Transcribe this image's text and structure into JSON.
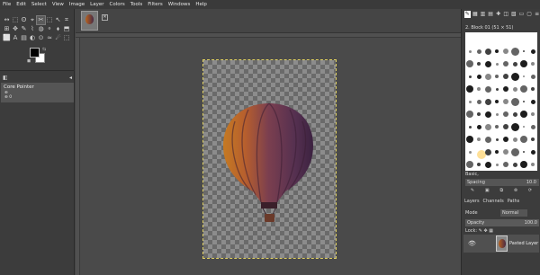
{
  "menu": [
    "File",
    "Edit",
    "Select",
    "View",
    "Image",
    "Layer",
    "Colors",
    "Tools",
    "Filters",
    "Windows",
    "Help"
  ],
  "toolbox": {
    "tools": [
      "↔",
      "⬚",
      "ʘ",
      "⌖",
      "✂",
      "⬚",
      "↖",
      "⌗",
      "⊞",
      "✥",
      "✎",
      "⌇",
      "◍",
      "⚬",
      "⬧",
      "⬒",
      "⬜",
      "A",
      "▤",
      "◐",
      "⊙",
      "≈",
      "☄",
      "⬚"
    ],
    "panel_tab": "◧",
    "panel_title": "Core Pointer",
    "panel_lines": [
      "⊕",
      "⊕ 0"
    ]
  },
  "dock": {
    "tabs": [
      "✎",
      "▦",
      "▥",
      "▤",
      "✚",
      "◫",
      "▧",
      "▭",
      "▢",
      "≡"
    ],
    "brush_name": "2. Block 01 (51 × 51)",
    "preset": "Basic,",
    "spacing_label": "Spacing",
    "spacing_value": "10.0",
    "layer_tabs": [
      "Layers",
      "Channels",
      "Paths"
    ],
    "mode_label": "Mode",
    "mode_value": "Normal",
    "opacity_label": "Opacity",
    "opacity_value": "100.0",
    "lock_label": "Lock:",
    "layer_name": "Pasted Layer"
  },
  "colors": {
    "canvas_bg": "#4a4a4a",
    "foreground": "#000000",
    "background": "#ffffff",
    "balloon_orange": "#c9761f",
    "balloon_purple": "#553050"
  }
}
